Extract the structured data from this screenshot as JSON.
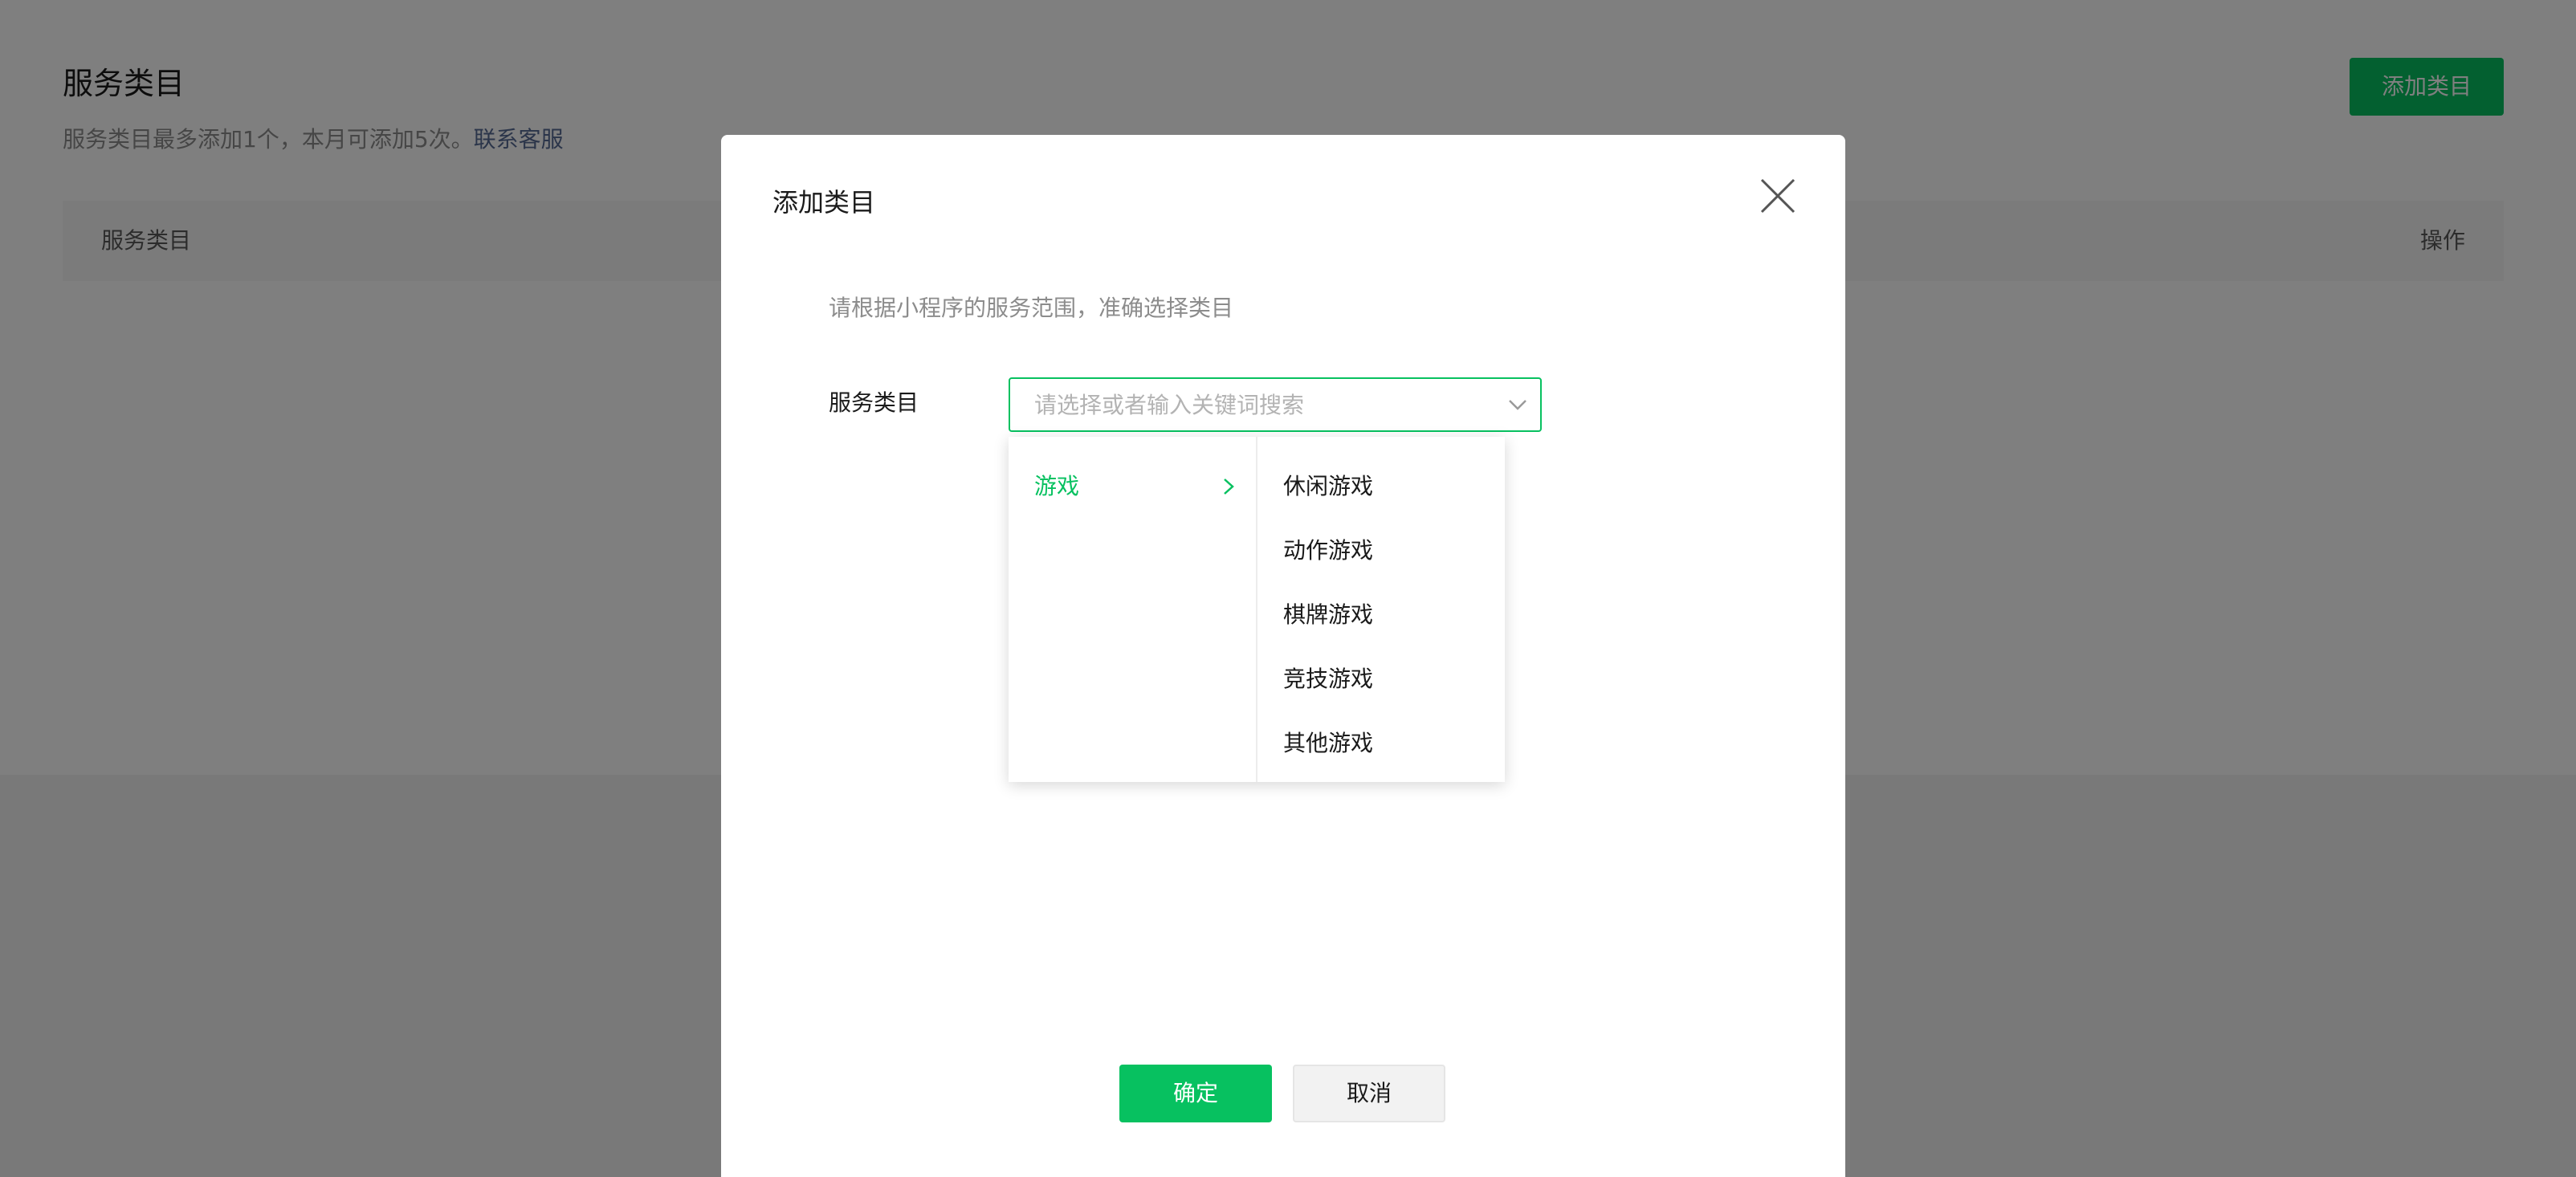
{
  "page": {
    "title": "服务类目",
    "description": "服务类目最多添加1个，本月可添加5次。",
    "contact_link": "联系客服",
    "add_button": "添加类目",
    "table": {
      "columns": [
        "服务类目",
        "操作"
      ]
    }
  },
  "dialog": {
    "title": "添加类目",
    "hint": "请根据小程序的服务范围，准确选择类目",
    "field_label": "服务类目",
    "select": {
      "placeholder": "请选择或者输入关键词搜索",
      "value": ""
    },
    "cascader": {
      "categories": [
        {
          "label": "游戏",
          "active": true
        }
      ],
      "subcategories": [
        "休闲游戏",
        "动作游戏",
        "棋牌游戏",
        "竞技游戏",
        "其他游戏"
      ]
    },
    "confirm_button": "确定",
    "cancel_button": "取消"
  },
  "colors": {
    "accent": "#07c160",
    "link": "#576b95",
    "overlay": "rgba(0,0,0,0.5)"
  },
  "icons": [
    "close-icon",
    "chevron-down-icon",
    "chevron-right-icon"
  ]
}
